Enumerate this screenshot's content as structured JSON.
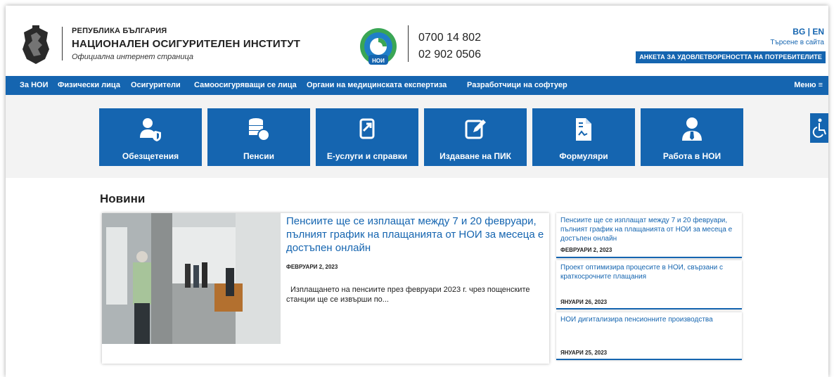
{
  "header": {
    "org_line1": "РЕПУБЛИКА БЪЛГАРИЯ",
    "org_line2": "НАЦИОНАЛЕН ОСИГУРИТЕЛЕН ИНСТИТУТ",
    "org_line3": "Официална интернет страница",
    "logo_text": "НОИ",
    "phone1": "0700 14 802",
    "phone2": "02 902 0506",
    "lang_bg": "BG",
    "lang_sep": "|",
    "lang_en": "EN",
    "site_search": "Търсене в сайта",
    "survey_button": "АНКЕТА ЗА УДОВЛЕТВОРЕНОСТТА НА ПОТРЕБИТЕЛИТЕ"
  },
  "nav": {
    "items": [
      "За НОИ",
      "Физически лица",
      "Осигурители",
      "Самоосигуряващи се лица",
      "Органи на медицинската експертиза",
      "Разработчици на софтуер"
    ],
    "menu": "Меню ≡"
  },
  "tiles": [
    {
      "label": "Обезщетения",
      "icon": "user-shield-icon"
    },
    {
      "label": "Пенсии",
      "icon": "coins-icon"
    },
    {
      "label": "Е-услуги и справки",
      "icon": "tablet-login-icon"
    },
    {
      "label": "Издаване на ПИК",
      "icon": "edit-icon"
    },
    {
      "label": "Формуляри",
      "icon": "document-icon"
    },
    {
      "label": "Работа в НОИ",
      "icon": "user-tie-icon"
    }
  ],
  "news": {
    "heading": "Новини",
    "feature": {
      "title": "Пенсиите ще се изплащат между 7 и 20 февруари, пълният график на плащанията от НОИ за месеца е достъпен онлайн",
      "date": "ФЕВРУАРИ 2, 2023",
      "excerpt": "Изплащането на пенсиите през февруари 2023 г. чрез пощенските станции ще се извърши по..."
    },
    "side": [
      {
        "title": "Пенсиите ще се изплащат между 7 и 20 февруари, пълният график на плащанията от НОИ за месеца е достъпен онлайн",
        "date": "ФЕВРУАРИ 2, 2023"
      },
      {
        "title": "Проект оптимизира процесите в НОИ, свързани с краткосрочните плащания",
        "date": "ЯНУАРИ 26, 2023"
      },
      {
        "title": "НОИ дигитализира пенсионните производства",
        "date": "ЯНУАРИ 25, 2023"
      }
    ]
  },
  "colors": {
    "brand_blue": "#1565b0",
    "band_gray": "#f3f3f3",
    "logo_green": "#3aa655"
  }
}
